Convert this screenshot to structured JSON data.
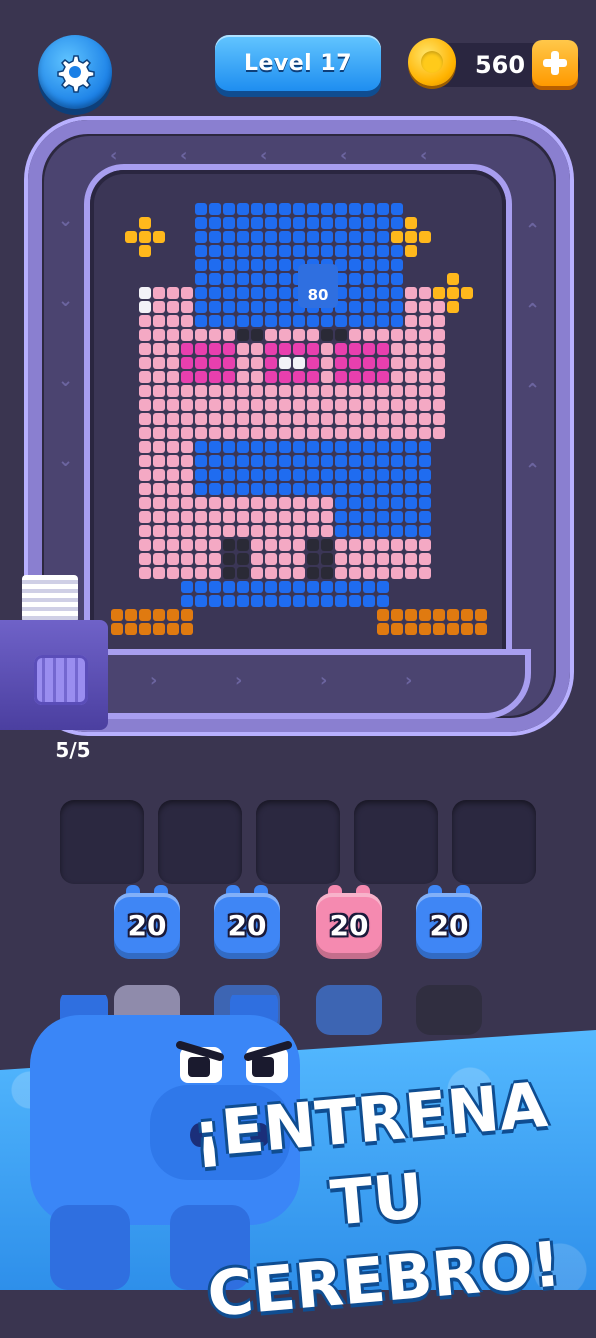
{
  "top_bar": {
    "settings_icon": "gear-icon",
    "level_label": "Level 17",
    "coins": "560",
    "coin_icon": "coin-icon",
    "add_icon": "plus-icon"
  },
  "board": {
    "puzzle_target_count": "80",
    "ammo_counter": "5/5",
    "colors": {
      "blue": "#1f6cf0",
      "pink": "#f4a9c4",
      "magenta": "#e83fae",
      "white": "#f2f2f7",
      "black": "#2a2a36",
      "gold": "#ffb81c",
      "orange": "#e07a10"
    }
  },
  "slots": {
    "count": 5
  },
  "shooters": [
    {
      "value": "20",
      "color": "#3f86f5"
    },
    {
      "value": "20",
      "color": "#3f86f5"
    },
    {
      "value": "20",
      "color": "#f58ab0"
    },
    {
      "value": "20",
      "color": "#3f86f5"
    }
  ],
  "queue_shooters": [
    {
      "color": "#c8c4e8"
    },
    {
      "color": "#3f86f5"
    },
    {
      "color": "#3f86f5"
    },
    {
      "color": "#2a2a36"
    }
  ],
  "banner": {
    "headline": "¡ENTRENA TU CEREBRO!",
    "background": "#3aa4f5"
  }
}
